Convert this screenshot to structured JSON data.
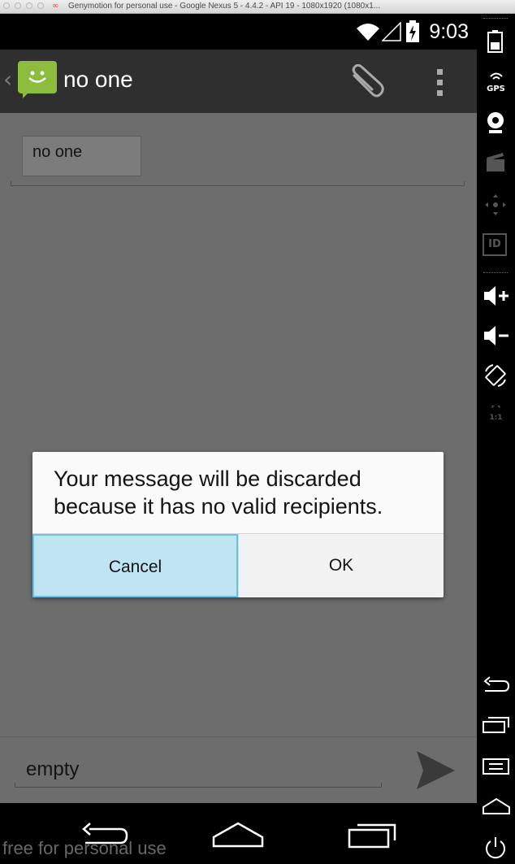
{
  "window": {
    "title": "Genymotion for personal use - Google Nexus 5 - 4.4.2 - API 19 - 1080x1920 (1080x1..."
  },
  "status_bar": {
    "time": "9:03",
    "icons": [
      "wifi-icon",
      "signal-icon",
      "battery-charging-icon"
    ]
  },
  "action_bar": {
    "title": "no one",
    "icons": [
      "messaging-app-icon",
      "paperclip-icon",
      "overflow-menu-icon"
    ]
  },
  "recipients": {
    "chip": "no one"
  },
  "dialog": {
    "message": "Your message will be discarded because it has no valid recipients.",
    "cancel_label": "Cancel",
    "ok_label": "OK"
  },
  "compose": {
    "text": "empty",
    "send_icon": "send-icon"
  },
  "navigation": {
    "icons": [
      "back-icon",
      "home-icon",
      "recent-apps-icon"
    ]
  },
  "watermark": "free for personal use",
  "sidebar": {
    "gps_label": "GPS",
    "id_label": "ID",
    "scale_label": "1:1",
    "icons": [
      "battery-icon",
      "gps-icon",
      "webcam-icon",
      "clapperboard-icon",
      "dpad-icon",
      "id-icon",
      "volume-up-icon",
      "volume-down-icon",
      "rotate-icon",
      "scale-icon",
      "back-icon",
      "recent-apps-icon",
      "menu-icon",
      "home-icon",
      "power-icon"
    ]
  },
  "colors": {
    "dialog_selected": "#bfe4f2",
    "dialog_selected_border": "#67c4e8",
    "app_icon": "#8cbd3f",
    "dim_overlay": "#6d6d6d"
  }
}
